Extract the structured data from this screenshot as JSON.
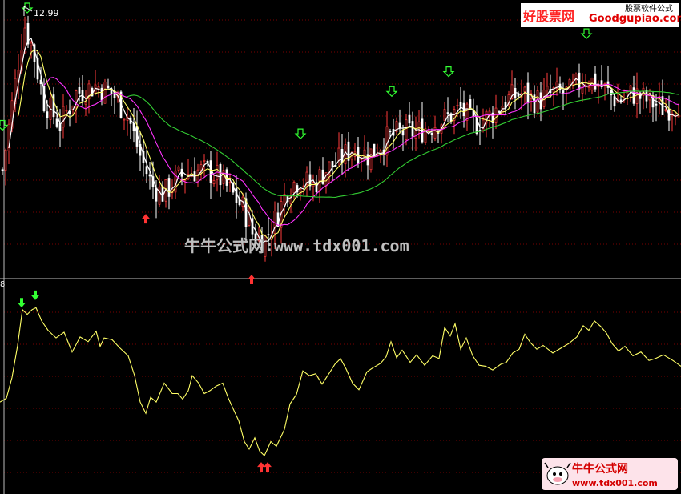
{
  "price_panel": {
    "high_label": "12.99"
  },
  "indicator_panel": {
    "label": "8"
  },
  "logo_top": {
    "brand": "好股票网",
    "site": "Goodgupiao.com",
    "subtitle": "股票软件公式"
  },
  "watermark": {
    "text": "牛牛公式网:www.tdx001.com"
  },
  "logo_bottom": {
    "brand": "牛牛公式网",
    "site": "www.tdx001.com"
  },
  "colors": {
    "background": "#000000",
    "candle_up": "#ff3b3b",
    "candle_down": "#ffffff",
    "ma_short": "#ffffff",
    "ma_mid": "#ffff66",
    "ma_long": "#ff33ff",
    "ma_very_long": "#33cc33",
    "indicator": "#ffff66",
    "sell_arrow": "#33ff33",
    "buy_arrow": "#ff3333",
    "grid": "#7a0000"
  },
  "chart_data": [
    {
      "type": "candlestick",
      "title": "",
      "max_price_label": "12.99",
      "signals": {
        "sell_arrows": [
          3,
          34,
          375,
          489,
          560,
          732
        ],
        "buy_arrows": [
          182,
          314
        ]
      },
      "series": [
        {
          "name": "",
          "values": [
            [
              0,
              10.7
            ],
            [
              30,
              12.8
            ],
            [
              40,
              12.5
            ],
            [
              55,
              11.8
            ],
            [
              75,
              11.5
            ],
            [
              95,
              11.9
            ],
            [
              120,
              12.0
            ],
            [
              140,
              11.9
            ],
            [
              160,
              11.6
            ],
            [
              175,
              11.1
            ],
            [
              190,
              10.7
            ],
            [
              205,
              10.6
            ],
            [
              220,
              10.8
            ],
            [
              240,
              10.9
            ],
            [
              260,
              10.9
            ],
            [
              275,
              10.8
            ],
            [
              290,
              10.6
            ],
            [
              305,
              10.4
            ],
            [
              315,
              10.1
            ],
            [
              330,
              10.0
            ],
            [
              345,
              10.3
            ],
            [
              360,
              10.7
            ],
            [
              375,
              10.8
            ],
            [
              390,
              10.7
            ],
            [
              405,
              10.9
            ],
            [
              420,
              11.0
            ],
            [
              440,
              11.2
            ],
            [
              460,
              11.1
            ],
            [
              480,
              11.3
            ],
            [
              500,
              11.4
            ],
            [
              520,
              11.4
            ],
            [
              540,
              11.5
            ],
            [
              560,
              11.6
            ],
            [
              575,
              11.7
            ],
            [
              590,
              11.5
            ],
            [
              610,
              11.6
            ],
            [
              630,
              11.8
            ],
            [
              650,
              11.9
            ],
            [
              670,
              11.8
            ],
            [
              690,
              11.9
            ],
            [
              710,
              11.9
            ],
            [
              730,
              12.1
            ],
            [
              750,
              12.0
            ],
            [
              770,
              11.8
            ],
            [
              790,
              11.9
            ],
            [
              810,
              11.8
            ],
            [
              830,
              11.7
            ],
            [
              850,
              11.8
            ]
          ]
        }
      ]
    },
    {
      "type": "line",
      "title": "",
      "signals": {
        "sell_arrows": [
          27,
          44
        ],
        "buy_arrows": [
          330
        ]
      },
      "series": [
        {
          "name": "",
          "values": [
            [
              0,
              62
            ],
            [
              8,
              66
            ],
            [
              15,
              88
            ],
            [
              22,
              122
            ],
            [
              28,
              160
            ],
            [
              34,
              155
            ],
            [
              40,
              160
            ],
            [
              45,
              162
            ],
            [
              52,
              148
            ],
            [
              60,
              138
            ],
            [
              70,
              130
            ],
            [
              80,
              136
            ],
            [
              90,
              115
            ],
            [
              100,
              131
            ],
            [
              110,
              126
            ],
            [
              120,
              137
            ],
            [
              125,
              121
            ],
            [
              130,
              130
            ],
            [
              140,
              128
            ],
            [
              150,
              119
            ],
            [
              160,
              111
            ],
            [
              168,
              90
            ],
            [
              175,
              62
            ],
            [
              182,
              50
            ],
            [
              188,
              67
            ],
            [
              195,
              62
            ],
            [
              205,
              82
            ],
            [
              215,
              71
            ],
            [
              222,
              71
            ],
            [
              228,
              65
            ],
            [
              235,
              74
            ],
            [
              240,
              90
            ],
            [
              248,
              82
            ],
            [
              255,
              71
            ],
            [
              262,
              74
            ],
            [
              270,
              79
            ],
            [
              278,
              82
            ],
            [
              285,
              66
            ],
            [
              292,
              53
            ],
            [
              298,
              42
            ],
            [
              305,
              20
            ],
            [
              311,
              12
            ],
            [
              318,
              24
            ],
            [
              324,
              10
            ],
            [
              330,
              5
            ],
            [
              338,
              20
            ],
            [
              345,
              15
            ],
            [
              355,
              33
            ],
            [
              362,
              60
            ],
            [
              370,
              70
            ],
            [
              378,
              95
            ],
            [
              386,
              90
            ],
            [
              394,
              92
            ],
            [
              402,
              81
            ],
            [
              412,
              94
            ],
            [
              418,
              102
            ],
            [
              425,
              108
            ],
            [
              432,
              97
            ],
            [
              440,
              82
            ],
            [
              448,
              75
            ],
            [
              458,
              94
            ],
            [
              465,
              98
            ],
            [
              475,
              103
            ],
            [
              482,
              110
            ],
            [
              488,
              126
            ],
            [
              495,
              109
            ],
            [
              502,
              117
            ],
            [
              512,
              104
            ],
            [
              520,
              112
            ],
            [
              530,
              101
            ],
            [
              540,
              111
            ],
            [
              548,
              108
            ],
            [
              555,
              141
            ],
            [
              562,
              132
            ],
            [
              568,
              145
            ],
            [
              575,
              118
            ],
            [
              582,
              130
            ],
            [
              590,
              111
            ],
            [
              598,
              101
            ],
            [
              606,
              100
            ],
            [
              615,
              96
            ],
            [
              625,
              102
            ],
            [
              632,
              104
            ],
            [
              640,
              114
            ],
            [
              648,
              118
            ],
            [
              655,
              134
            ],
            [
              662,
              125
            ],
            [
              670,
              118
            ],
            [
              678,
              122
            ],
            [
              690,
              114
            ],
            [
              700,
              119
            ],
            [
              710,
              124
            ],
            [
              720,
              131
            ],
            [
              728,
              143
            ],
            [
              735,
              138
            ],
            [
              742,
              148
            ],
            [
              750,
              142
            ],
            [
              757,
              135
            ],
            [
              764,
              124
            ],
            [
              772,
              116
            ],
            [
              780,
              121
            ],
            [
              790,
              111
            ],
            [
              800,
              115
            ],
            [
              810,
              106
            ],
            [
              818,
              108
            ],
            [
              828,
              112
            ],
            [
              840,
              106
            ],
            [
              850,
              100
            ]
          ]
        }
      ]
    }
  ]
}
